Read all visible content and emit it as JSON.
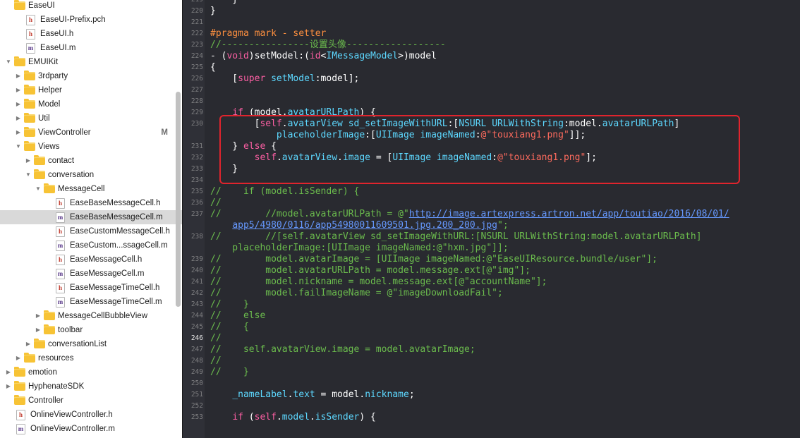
{
  "navigator": {
    "items": [
      {
        "label": "EaseUI",
        "kind": "folder",
        "indent": 0,
        "disclosure": "none"
      },
      {
        "label": "EaseUI-Prefix.pch",
        "kind": "h",
        "indent": 1,
        "disclosure": "none"
      },
      {
        "label": "EaseUI.h",
        "kind": "h",
        "indent": 1,
        "disclosure": "none"
      },
      {
        "label": "EaseUI.m",
        "kind": "m",
        "indent": 1,
        "disclosure": "none"
      },
      {
        "label": "EMUIKit",
        "kind": "folder",
        "indent": 0,
        "disclosure": "open"
      },
      {
        "label": "3rdparty",
        "kind": "folder",
        "indent": 1,
        "disclosure": "closed"
      },
      {
        "label": "Helper",
        "kind": "folder",
        "indent": 1,
        "disclosure": "closed"
      },
      {
        "label": "Model",
        "kind": "folder",
        "indent": 1,
        "disclosure": "closed"
      },
      {
        "label": "Util",
        "kind": "folder",
        "indent": 1,
        "disclosure": "closed"
      },
      {
        "label": "ViewController",
        "kind": "folder",
        "indent": 1,
        "disclosure": "closed",
        "badge": "M"
      },
      {
        "label": "Views",
        "kind": "folder",
        "indent": 1,
        "disclosure": "open"
      },
      {
        "label": "contact",
        "kind": "folder",
        "indent": 2,
        "disclosure": "closed"
      },
      {
        "label": "conversation",
        "kind": "folder",
        "indent": 2,
        "disclosure": "open"
      },
      {
        "label": "MessageCell",
        "kind": "folder",
        "indent": 3,
        "disclosure": "open"
      },
      {
        "label": "EaseBaseMessageCell.h",
        "kind": "h",
        "indent": 4,
        "disclosure": "none"
      },
      {
        "label": "EaseBaseMessageCell.m",
        "kind": "m",
        "indent": 4,
        "disclosure": "none",
        "selected": true
      },
      {
        "label": "EaseCustomMessageCell.h",
        "kind": "h",
        "indent": 4,
        "disclosure": "none"
      },
      {
        "label": "EaseCustom...ssageCell.m",
        "kind": "m",
        "indent": 4,
        "disclosure": "none"
      },
      {
        "label": "EaseMessageCell.h",
        "kind": "h",
        "indent": 4,
        "disclosure": "none"
      },
      {
        "label": "EaseMessageCell.m",
        "kind": "m",
        "indent": 4,
        "disclosure": "none"
      },
      {
        "label": "EaseMessageTimeCell.h",
        "kind": "h",
        "indent": 4,
        "disclosure": "none"
      },
      {
        "label": "EaseMessageTimeCell.m",
        "kind": "m",
        "indent": 4,
        "disclosure": "none"
      },
      {
        "label": "MessageCellBubbleView",
        "kind": "folder",
        "indent": 3,
        "disclosure": "closed"
      },
      {
        "label": "toolbar",
        "kind": "folder",
        "indent": 3,
        "disclosure": "closed"
      },
      {
        "label": "conversationList",
        "kind": "folder",
        "indent": 2,
        "disclosure": "closed"
      },
      {
        "label": "resources",
        "kind": "folder",
        "indent": 1,
        "disclosure": "closed"
      },
      {
        "label": "emotion",
        "kind": "folder",
        "indent": 0,
        "disclosure": "closed"
      },
      {
        "label": "HyphenateSDK",
        "kind": "folder",
        "indent": 0,
        "disclosure": "closed"
      },
      {
        "label": "Controller",
        "kind": "folder",
        "indent": 0,
        "disclosure": "none"
      },
      {
        "label": "OnlineViewController.h",
        "kind": "h",
        "indent": 0,
        "disclosure": "none"
      },
      {
        "label": "OnlineViewController.m",
        "kind": "m",
        "indent": 0,
        "disclosure": "none"
      }
    ]
  },
  "editor": {
    "current_line": "246",
    "lines": [
      {
        "n": "219",
        "html": "    }"
      },
      {
        "n": "220",
        "html": "}"
      },
      {
        "n": "221",
        "html": ""
      },
      {
        "n": "222",
        "html": "<span class='p'>#pragma mark - setter</span>"
      },
      {
        "n": "223",
        "html": "<span class='c'>//----------------设置头像------------------</span>"
      },
      {
        "n": "224",
        "html": "- (<span class='k'>void</span>)setModel:(<span class='k'>id</span>&lt;<span class='t'>IMessageModel</span>&gt;)model"
      },
      {
        "n": "225",
        "html": "{"
      },
      {
        "n": "226",
        "html": "    [<span class='k'>super</span> <span class='m'>setModel</span>:model];"
      },
      {
        "n": "227",
        "html": ""
      },
      {
        "n": "228",
        "html": ""
      },
      {
        "n": "229",
        "html": "    <span class='k'>if</span> (model.<span class='m'>avatarURLPath</span>) {"
      },
      {
        "n": "230",
        "html": "        [<span class='k'>self</span>.<span class='m'>avatarView</span> <span class='m'>sd_setImageWithURL</span>:[<span class='t'>NSURL</span> <span class='m'>URLWithString</span>:model.<span class='m'>avatarURLPath</span>]\n            <span class='m'>placeholderImage</span>:[<span class='t'>UIImage</span> <span class='m'>imageNamed</span>:<span class='s'>@\"touxiang1.png\"</span>]];"
      },
      {
        "n": "231",
        "html": "    } <span class='k'>else</span> {"
      },
      {
        "n": "232",
        "html": "        <span class='k'>self</span>.<span class='m'>avatarView</span>.<span class='m'>image</span> = [<span class='t'>UIImage</span> <span class='m'>imageNamed</span>:<span class='s'>@\"touxiang1.png\"</span>];"
      },
      {
        "n": "233",
        "html": "    }"
      },
      {
        "n": "234",
        "html": ""
      },
      {
        "n": "235",
        "html": "<span class='c'>//    if (model.isSender) {</span>"
      },
      {
        "n": "236",
        "html": "<span class='c'>//</span>"
      },
      {
        "n": "237",
        "html": "<span class='c'>//        //model.avatarURLPath = @\"<span class='u'>http://image.artexpress.artron.net/app/toutiao/2016/08/01/</span>\n    <span class='u'>app5/4980/0116/app54980011609501.jpg.200_200.jpg</span>\";</span>"
      },
      {
        "n": "238",
        "html": "<span class='c'>//        //[self.avatarView sd_setImageWithURL:[NSURL URLWithString:model.avatarURLPath]\n    placeholderImage:[UIImage imageNamed:@\"hxm.jpg\"]];</span>"
      },
      {
        "n": "239",
        "html": "<span class='c'>//        model.avatarImage = [UIImage imageNamed:@\"EaseUIResource.bundle/user\"];</span>"
      },
      {
        "n": "240",
        "html": "<span class='c'>//        model.avatarURLPath = model.message.ext[@\"img\"];</span>"
      },
      {
        "n": "241",
        "html": "<span class='c'>//        model.nickname = model.message.ext[@\"accountName\"];</span>"
      },
      {
        "n": "242",
        "html": "<span class='c'>//        model.failImageName = @\"imageDownloadFail\";</span>"
      },
      {
        "n": "243",
        "html": "<span class='c'>//    }</span>"
      },
      {
        "n": "244",
        "html": "<span class='c'>//    else</span>"
      },
      {
        "n": "245",
        "html": "<span class='c'>//    {</span>"
      },
      {
        "n": "246",
        "html": "<span class='c'>//</span>"
      },
      {
        "n": "247",
        "html": "<span class='c'>//    self.avatarView.image = model.avatarImage;</span>"
      },
      {
        "n": "248",
        "html": "<span class='c'>//</span>"
      },
      {
        "n": "249",
        "html": "<span class='c'>//    }</span>"
      },
      {
        "n": "250",
        "html": ""
      },
      {
        "n": "251",
        "html": "    <span class='m'>_nameLabel</span>.<span class='m'>text</span> = model.<span class='m'>nickname</span>;"
      },
      {
        "n": "252",
        "html": ""
      },
      {
        "n": "253",
        "html": "    <span class='k'>if</span> (<span class='k'>self</span>.<span class='m'>model</span>.<span class='m'>isSender</span>) {"
      }
    ]
  },
  "colors": {
    "accent_box": "#e0242d",
    "editor_bg": "#292a30"
  }
}
